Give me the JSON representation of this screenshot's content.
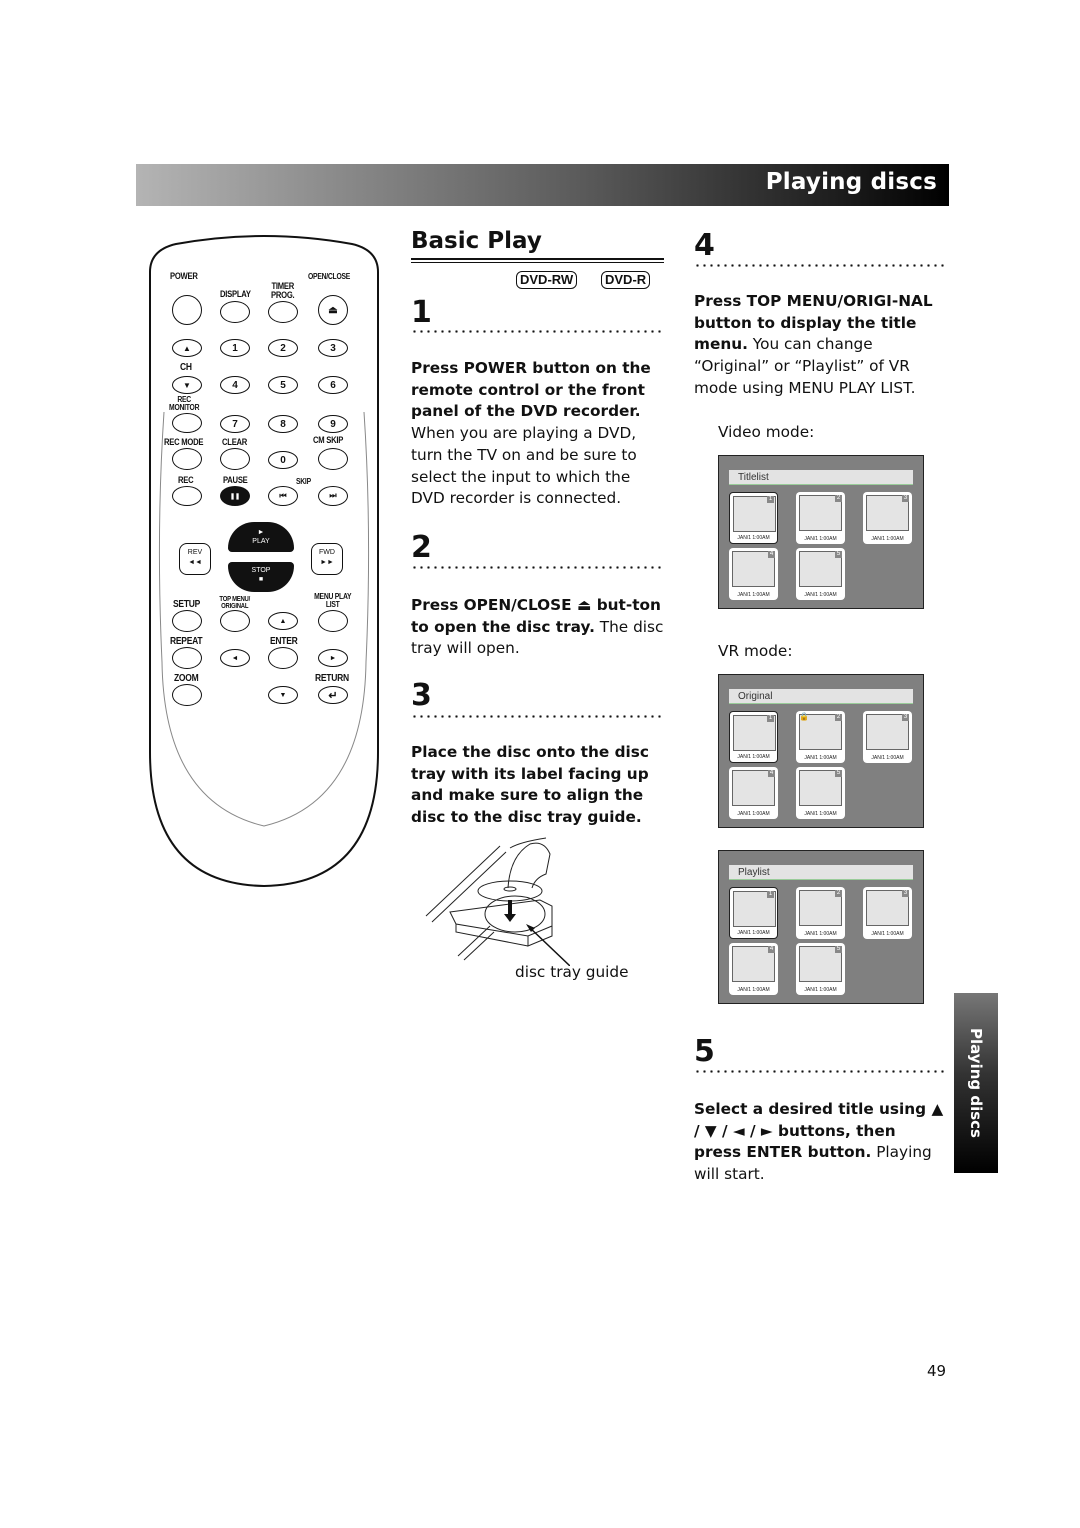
{
  "header": {
    "section_title": "Playing discs"
  },
  "remote": {
    "labels": {
      "power": "POWER",
      "open_close": "OPEN/CLOSE",
      "display": "DISPLAY",
      "timer_prog": "TIMER PROG.",
      "ch": "CH",
      "rec_monitor": "REC MONITOR",
      "rec_mode": "REC MODE",
      "clear": "CLEAR",
      "cm_skip": "CM SKIP",
      "rec": "REC",
      "pause": "PAUSE",
      "skip": "SKIP",
      "play": "PLAY",
      "rev": "REV",
      "fwd": "FWD",
      "stop": "STOP",
      "setup": "SETUP",
      "top_menu_original": "TOP MENU/ ORIGINAL",
      "menu_play_list": "MENU PLAY LIST",
      "repeat": "REPEAT",
      "enter": "ENTER",
      "zoom": "ZOOM",
      "return": "RETURN"
    },
    "digits": [
      "1",
      "2",
      "3",
      "4",
      "5",
      "6",
      "7",
      "8",
      "9",
      "0"
    ],
    "glyphs": {
      "eject": "⏏",
      "up": "▲",
      "down": "▼",
      "left": "◄",
      "right": "►",
      "pause": "❚❚",
      "skip_back": "⏮",
      "skip_fwd": "⏭",
      "rev": "◄◄",
      "fwd": "►►",
      "play": "►",
      "stop": "■",
      "return": "↵"
    }
  },
  "main": {
    "title": "Basic Play",
    "badges": [
      "DVD-RW",
      "DVD-R"
    ],
    "steps": [
      {
        "number": "1",
        "bold": "Press POWER button on the remote control or the front panel of the DVD recorder.",
        "normal": "When you are playing a DVD, turn the TV on and be sure to select the input to which the DVD recorder is connected."
      },
      {
        "number": "2",
        "bold": "Press OPEN/CLOSE ⏏ but-ton to open the disc tray.",
        "normal": "The disc tray will open."
      },
      {
        "number": "3",
        "bold": "Place the disc onto the disc tray with its label facing up and make sure to align the disc to the disc tray guide.",
        "normal": ""
      },
      {
        "number": "4",
        "bold": "Press TOP MENU/ORIGI-NAL button to display the title menu.",
        "normal": "You can change “Original” or “Playlist” of VR mode using MENU PLAY LIST."
      },
      {
        "number": "5",
        "bold": "Select a desired title using ▲ / ▼ / ◄ / ► buttons, then press ENTER button.",
        "normal": "Playing will start."
      }
    ],
    "illustration_caption": "disc tray guide",
    "video_mode_label": "Video mode:",
    "vr_mode_label": "VR mode:"
  },
  "screens": [
    {
      "header": "Titlelist",
      "thumbs": [
        {
          "n": "1",
          "date": "JAN/1  1:00AM",
          "selected": true
        },
        {
          "n": "2",
          "date": "JAN/1  1:00AM"
        },
        {
          "n": "3",
          "date": "JAN/1  1:00AM"
        },
        {
          "n": "4",
          "date": "JAN/1  1:00AM"
        },
        {
          "n": "5",
          "date": "JAN/1  1:00AM"
        }
      ]
    },
    {
      "header": "Original",
      "thumbs": [
        {
          "n": "1",
          "date": "JAN/1  1:00AM",
          "selected": true
        },
        {
          "n": "2",
          "date": "JAN/1  1:00AM",
          "locked": true
        },
        {
          "n": "3",
          "date": "JAN/1  1:00AM"
        },
        {
          "n": "4",
          "date": "JAN/1  1:00AM"
        },
        {
          "n": "5",
          "date": "JAN/1  1:00AM"
        }
      ]
    },
    {
      "header": "Playlist",
      "thumbs": [
        {
          "n": "1",
          "date": "JAN/1  1:00AM",
          "selected": true
        },
        {
          "n": "2",
          "date": "JAN/1  1:00AM"
        },
        {
          "n": "3",
          "date": "JAN/1  1:00AM"
        },
        {
          "n": "4",
          "date": "JAN/1  1:00AM"
        },
        {
          "n": "5",
          "date": "JAN/1  1:00AM"
        }
      ]
    }
  ],
  "side_tab": {
    "label": "Playing discs"
  },
  "page_number": "49"
}
